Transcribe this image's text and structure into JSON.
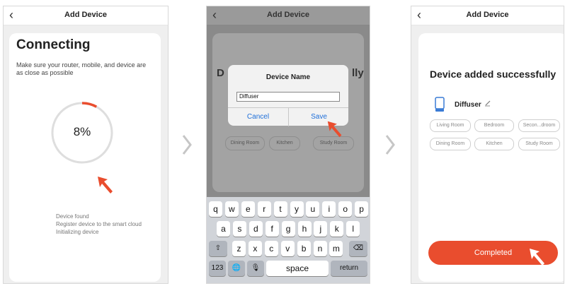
{
  "screen1": {
    "nav": {
      "back": "‹",
      "title": "Add Device"
    },
    "heading": "Connecting",
    "hint": "Make sure your router, mobile, and device are as close as possible",
    "progress": {
      "label": "8%",
      "value": 0.08
    },
    "steps": [
      "Device found",
      "Register device to the smart cloud",
      "Initializing device"
    ]
  },
  "screen2": {
    "nav": {
      "back": "‹",
      "title": "Add Device"
    },
    "background_text_left": "D",
    "background_text_right": "lly",
    "background_chips": [
      "Dining Room",
      "Kitchen",
      "Study Room"
    ],
    "dialog": {
      "title": "Device Name",
      "input_value": "Diffuser",
      "cancel": "Cancel",
      "save": "Save"
    },
    "keyboard": {
      "row1": [
        "q",
        "w",
        "e",
        "r",
        "t",
        "y",
        "u",
        "i",
        "o",
        "p"
      ],
      "row2": [
        "a",
        "s",
        "d",
        "f",
        "g",
        "h",
        "j",
        "k",
        "l"
      ],
      "row3": [
        "z",
        "x",
        "c",
        "v",
        "b",
        "n",
        "m"
      ],
      "shift_icon": "⇧",
      "backspace_icon": "⌫",
      "numbers": "123",
      "globe_icon": "🌐",
      "mic_icon": "🎙",
      "space": "space",
      "return": "return"
    }
  },
  "screen3": {
    "nav": {
      "back": "‹",
      "title": "Add Device"
    },
    "heading": "Device added successfully",
    "device_name": "Diffuser",
    "rooms_row1": [
      "Living Room",
      "Bedroom",
      "Secon...droom"
    ],
    "rooms_row2": [
      "Dining Room",
      "Kitchen",
      "Study Room"
    ],
    "completed": "Completed"
  },
  "colors": {
    "accent": "#e94d2e",
    "link": "#1e6fd9",
    "device_icon": "#3a7bd5"
  },
  "icons": [
    "back-arrow",
    "chevron-right",
    "edit-pencil",
    "pointer-arrow",
    "diffuser-device"
  ]
}
